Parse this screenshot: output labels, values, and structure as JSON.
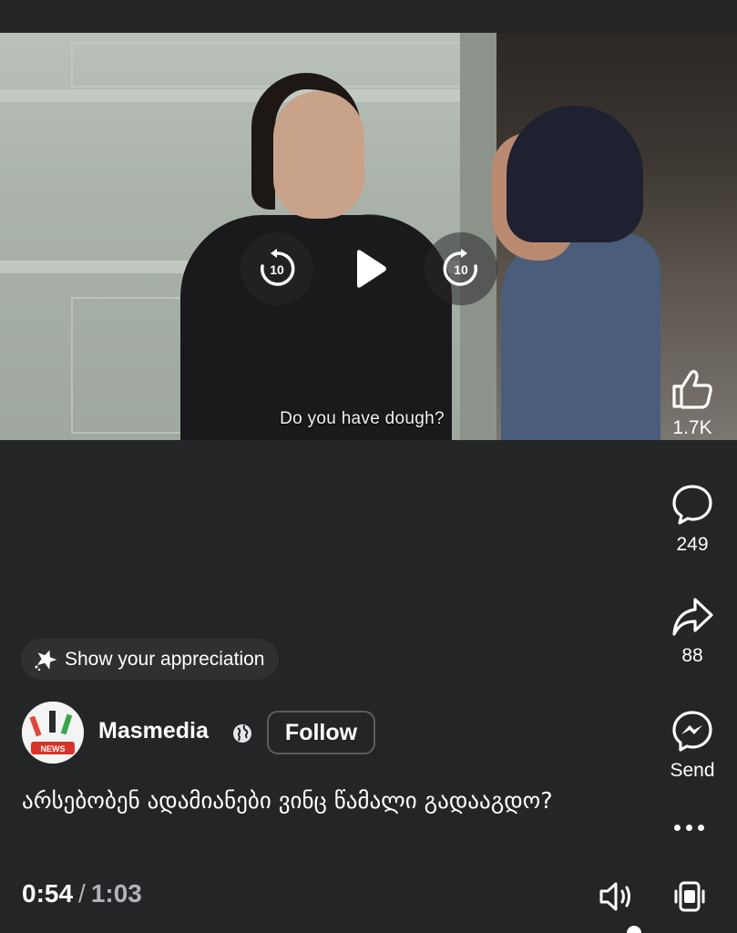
{
  "video": {
    "subtitle": "Do you have dough?",
    "rewind_seconds": "10",
    "forward_seconds": "10"
  },
  "actions": {
    "like_count": "1.7K",
    "comment_count": "249",
    "share_count": "88",
    "send_label": "Send"
  },
  "appreciation": {
    "label": "Show your appreciation"
  },
  "channel": {
    "name": "Masmedia",
    "follow_label": "Follow",
    "avatar_badge": "NEWS"
  },
  "post": {
    "caption": "არსებობენ ადამიანები ვინც წამალი გადააგდო?"
  },
  "playback": {
    "current_time": "0:54",
    "separator": "/",
    "duration": "1:03"
  },
  "icons": {
    "like": "thumbs-up-icon",
    "comment": "comment-bubble-icon",
    "share": "share-arrow-icon",
    "send": "messenger-icon",
    "more": "more-dots-icon",
    "volume": "volume-icon",
    "pip": "picture-in-picture-icon",
    "globe": "globe-icon",
    "appreciation": "star-sparkle-icon"
  }
}
